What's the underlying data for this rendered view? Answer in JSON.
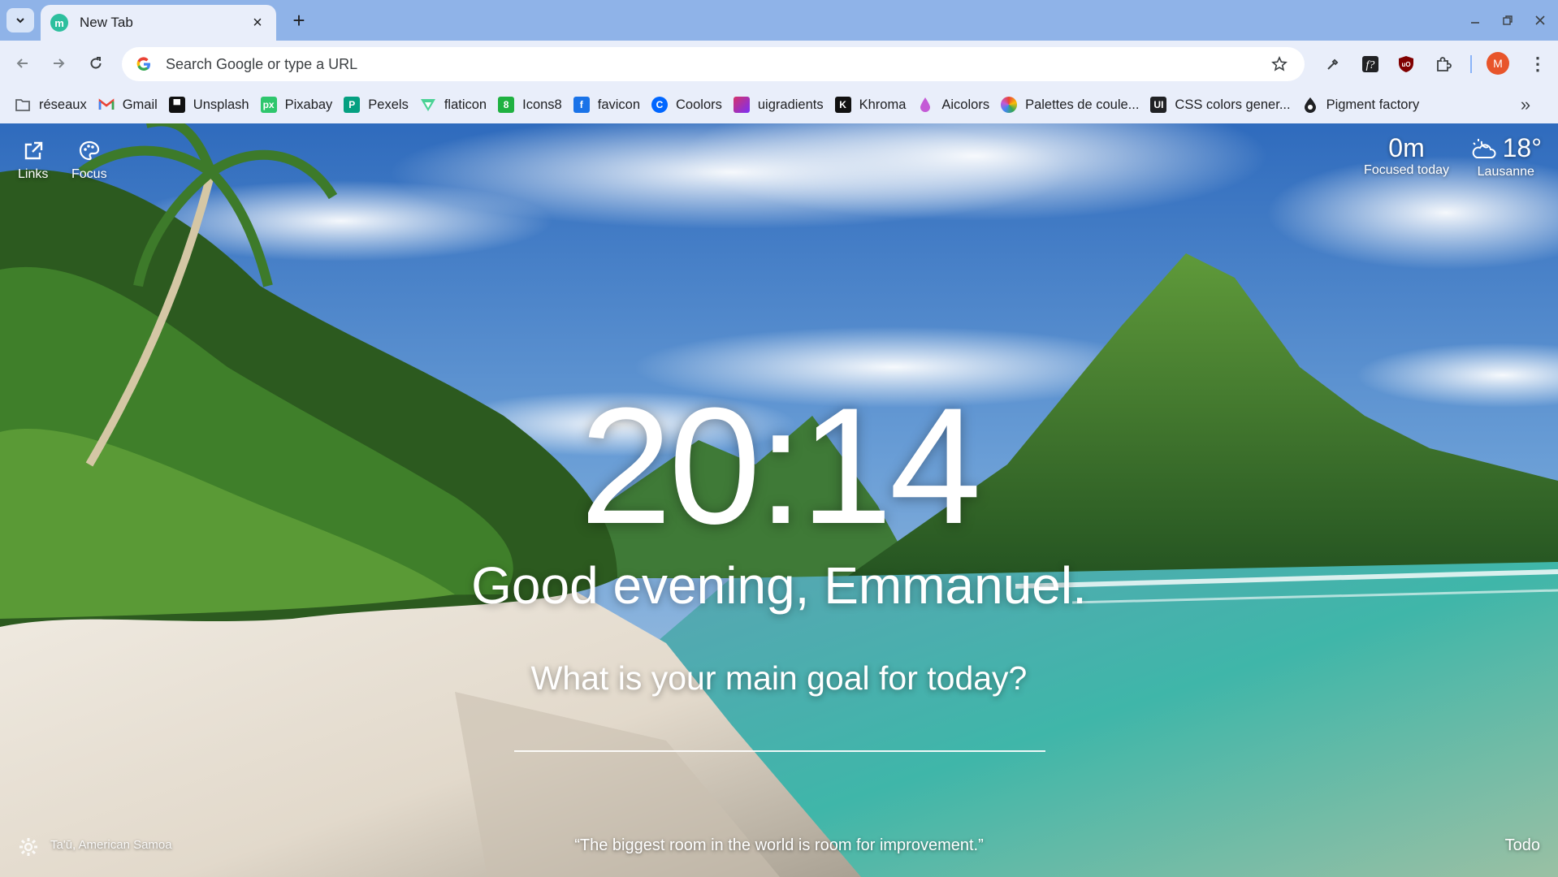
{
  "browser": {
    "tab": {
      "title": "New Tab",
      "favicon_letter": "m"
    },
    "omnibox": {
      "placeholder": "Search Google or type a URL"
    },
    "profile_initial": "M",
    "accent": "#8fb3e8"
  },
  "bookmarks": [
    {
      "label": "réseaux",
      "icon": "folder-icon",
      "color": "#5f6368",
      "glyph": ""
    },
    {
      "label": "Gmail",
      "icon": "gmail-icon",
      "color": "#ea4335",
      "glyph": "M"
    },
    {
      "label": "Unsplash",
      "icon": "unsplash-icon",
      "color": "#111111",
      "glyph": "▀"
    },
    {
      "label": "Pixabay",
      "icon": "pixabay-icon",
      "color": "#2ec66d",
      "glyph": "px"
    },
    {
      "label": "Pexels",
      "icon": "pexels-icon",
      "color": "#05a081",
      "glyph": "P"
    },
    {
      "label": "flaticon",
      "icon": "flaticon-icon",
      "color": "#4ad295",
      "glyph": "▽"
    },
    {
      "label": "Icons8",
      "icon": "icons8-icon",
      "color": "#1fb141",
      "glyph": "8"
    },
    {
      "label": "favicon",
      "icon": "favicon-site-icon",
      "color": "#1a73e8",
      "glyph": "f"
    },
    {
      "label": "Coolors",
      "icon": "coolors-icon",
      "color": "#0066ff",
      "glyph": "C"
    },
    {
      "label": "uigradients",
      "icon": "uigradients-icon",
      "color": "#c2378a",
      "glyph": ""
    },
    {
      "label": "Khroma",
      "icon": "khroma-icon",
      "color": "#111111",
      "glyph": "K"
    },
    {
      "label": "Aicolors",
      "icon": "aicolors-icon",
      "color": "#c45ad6",
      "glyph": "◆"
    },
    {
      "label": "Palettes de coule...",
      "icon": "palettes-icon",
      "color": "#f4b400",
      "glyph": "●"
    },
    {
      "label": "CSS colors gener...",
      "icon": "css-colors-icon",
      "color": "#202124",
      "glyph": "UI"
    },
    {
      "label": "Pigment factory",
      "icon": "pigment-factory-icon",
      "color": "#202124",
      "glyph": "●"
    }
  ],
  "momentum": {
    "links_label": "Links",
    "focus_label": "Focus",
    "focus_time": "0m",
    "focus_caption": "Focused today",
    "temperature": "18°",
    "city": "Lausanne",
    "clock": "20:14",
    "greeting": "Good evening, Emmanuel.",
    "goal_question": "What is your main goal for today?",
    "photo_location": "Ta'ū, American Samoa",
    "quote": "“The biggest room in the world is room for improvement.”",
    "todo_label": "Todo"
  }
}
